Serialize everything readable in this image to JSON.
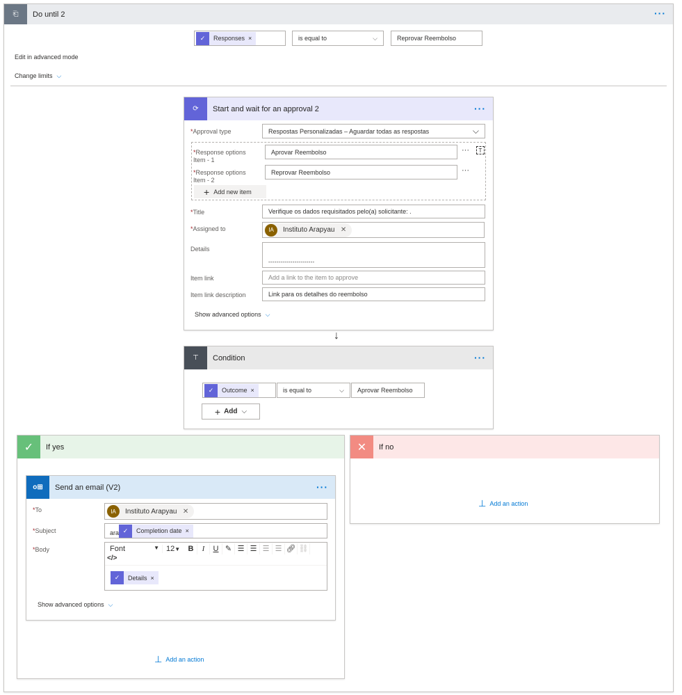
{
  "loop": {
    "title": "Do until 2",
    "condition": {
      "token": "Responses",
      "operator": "is equal to",
      "value": "Reprovar Reembolso"
    },
    "edit_advanced": "Edit in advanced mode",
    "change_limits": "Change limits"
  },
  "approval": {
    "title": "Start and wait for an approval 2",
    "approval_type_label": "Approval type",
    "approval_type_value": "Respostas Personalizadas – Aguardar todas as respostas",
    "items": [
      {
        "label": "Response options",
        "sub": "Item - 1",
        "value": "Aprovar Reembolso"
      },
      {
        "label": "Response options",
        "sub": "Item - 2",
        "value": "Reprovar Reembolso"
      }
    ],
    "add_item": "Add new item",
    "title_label": "Title",
    "title_value": "Verifique os dados requisitados pelo(a) solicitante: .",
    "assigned_label": "Assigned to",
    "assigned_value": "Instituto Arapyau",
    "assigned_initials": "IA",
    "details_label": "Details",
    "details_value": "- - - - - - - - - - - - - - - - - - - - - - -",
    "item_link_label": "Item link",
    "item_link_placeholder": "Add a link to the item to approve",
    "item_link_desc_label": "Item link description",
    "item_link_desc_value": "Link para os detalhes do reembolso",
    "show_advanced": "Show advanced options"
  },
  "condition": {
    "title": "Condition",
    "token": "Outcome",
    "operator": "is equal to",
    "value": "Aprovar Reembolso",
    "add": "Add"
  },
  "if_yes": {
    "title": "If yes",
    "add_action": "Add an action"
  },
  "if_no": {
    "title": "If no",
    "add_action": "Add an action"
  },
  "email": {
    "title": "Send an email (V2)",
    "to_label": "To",
    "to_value": "Instituto Arapyau",
    "to_initials": "IA",
    "subject_label": "Subject",
    "subject_prefix": "ara",
    "subject_token": "Completion date",
    "body_label": "Body",
    "font": "Font",
    "font_size": "12",
    "body_token": "Details",
    "show_advanced": "Show advanced options"
  },
  "colors": {
    "accent": "#0078d4",
    "approval": "#6264d8",
    "yes": "#5cb85c",
    "no": "#f28b82",
    "outlook": "#0f6cbd"
  }
}
